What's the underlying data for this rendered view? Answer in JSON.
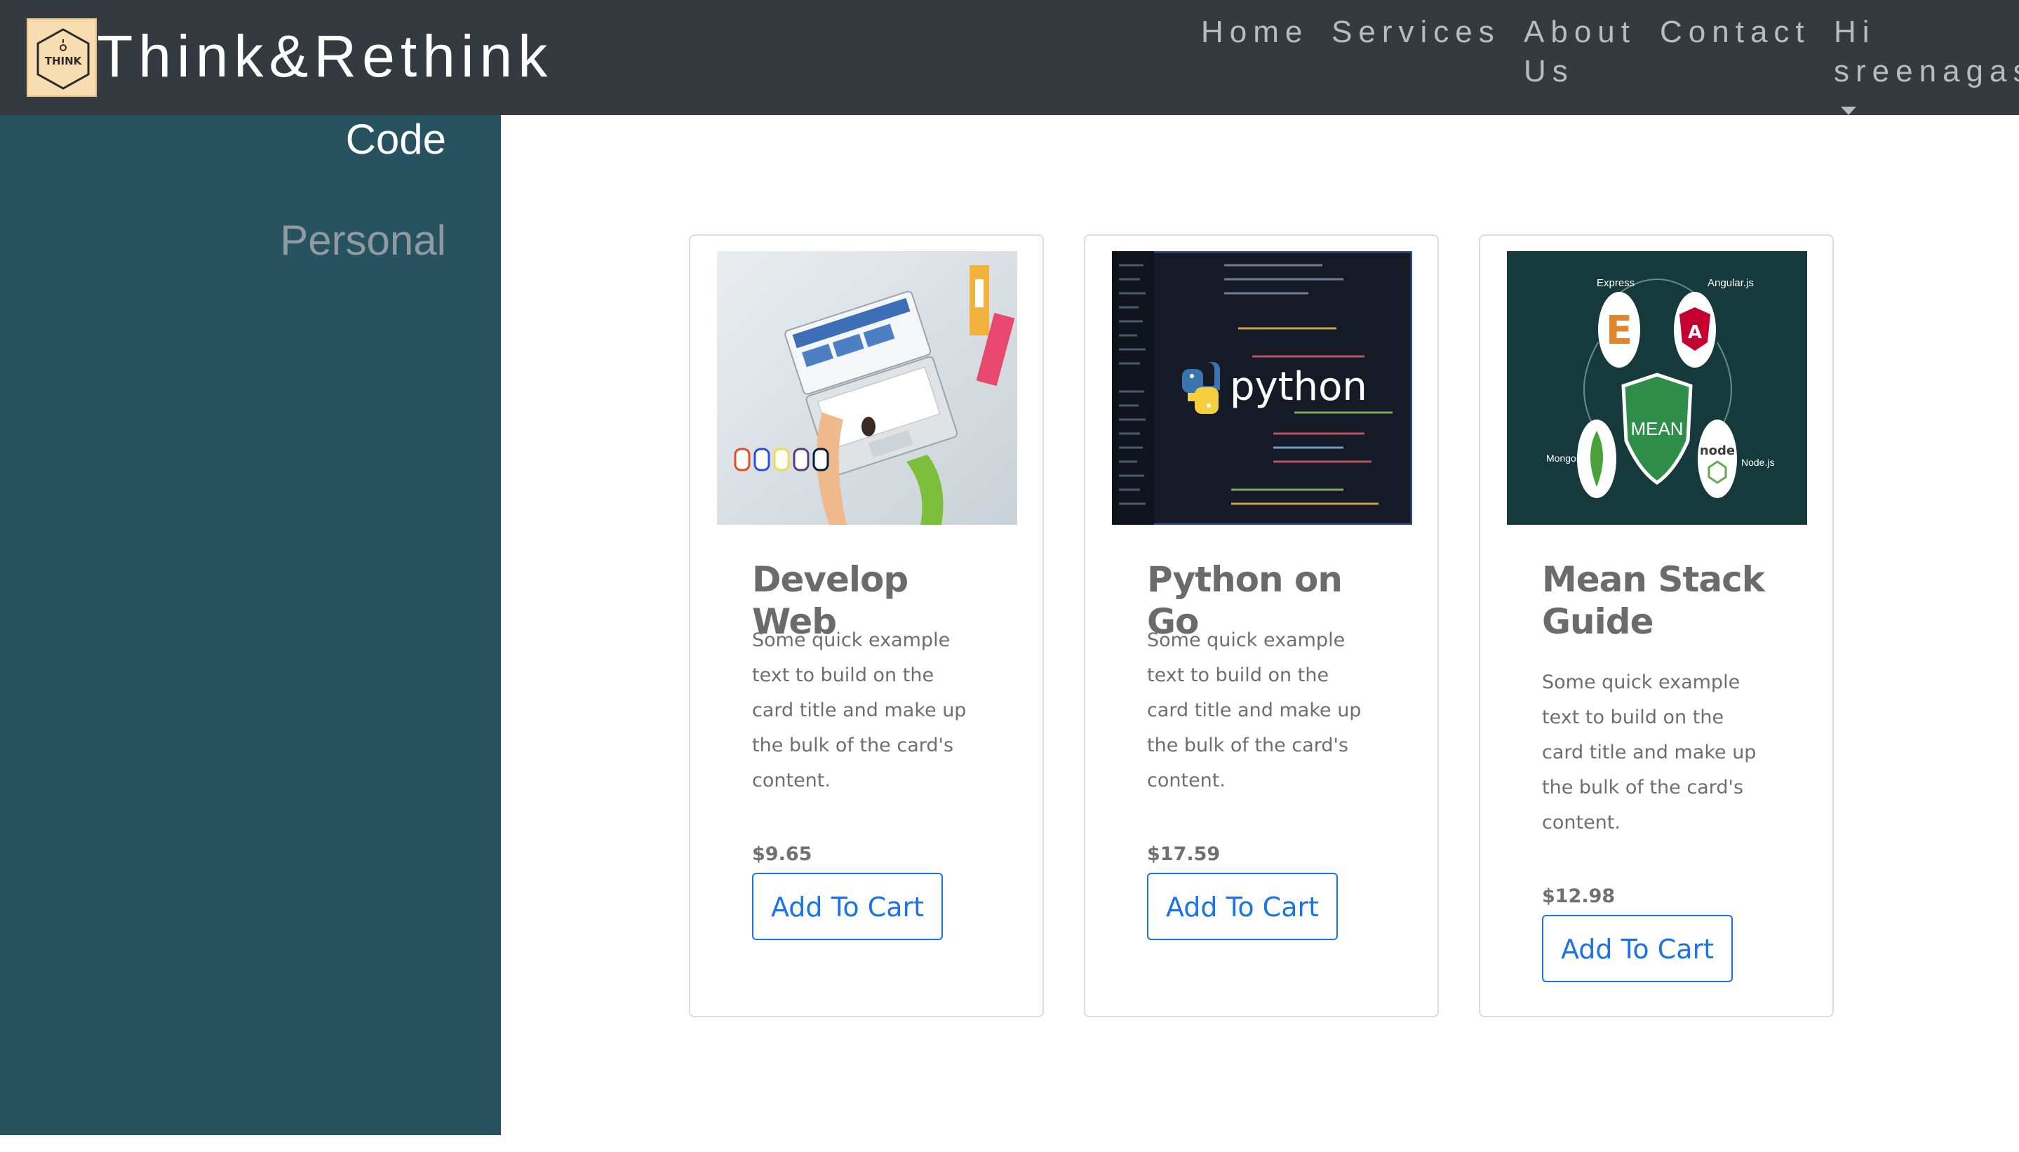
{
  "navbar": {
    "brand": "Think&Rethink",
    "logo_text": "THINK",
    "items": [
      {
        "label": "Home"
      },
      {
        "label": "Services"
      },
      {
        "label": "About Us"
      },
      {
        "label": "Contact"
      }
    ],
    "user_greeting": "Hi",
    "user_name": "sreenagas",
    "background_color": "#343a40"
  },
  "sidebar": {
    "items": [
      {
        "label": "Code",
        "active": true
      },
      {
        "label": "Personal",
        "active": false
      }
    ],
    "background_color": "#26535f"
  },
  "cards": [
    {
      "title": "Develop Web",
      "text": "Some quick example text to build on the card title and make up the bulk of the card's content.",
      "price": "$9.65",
      "button_label": "Add To Cart",
      "image_icon": "web-development-illustration"
    },
    {
      "title": "Python on Go",
      "text": "Some quick example text to build on the card title and make up the bulk of the card's content.",
      "price": "$17.59",
      "button_label": "Add To Cart",
      "image_icon": "python-code-illustration",
      "image_caption": "python"
    },
    {
      "title": "Mean Stack Guide",
      "text": "Some quick example text to build on the card title and make up the bulk of the card's content.",
      "price": "$12.98",
      "button_label": "Add To Cart",
      "image_icon": "mean-stack-illustration",
      "image_labels": [
        "Express",
        "Angular.js",
        "MEAN",
        "MongoDB",
        "Node.js"
      ]
    }
  ],
  "colors": {
    "accent": "#1a73e8",
    "title_gray": "#6b6b6b"
  }
}
